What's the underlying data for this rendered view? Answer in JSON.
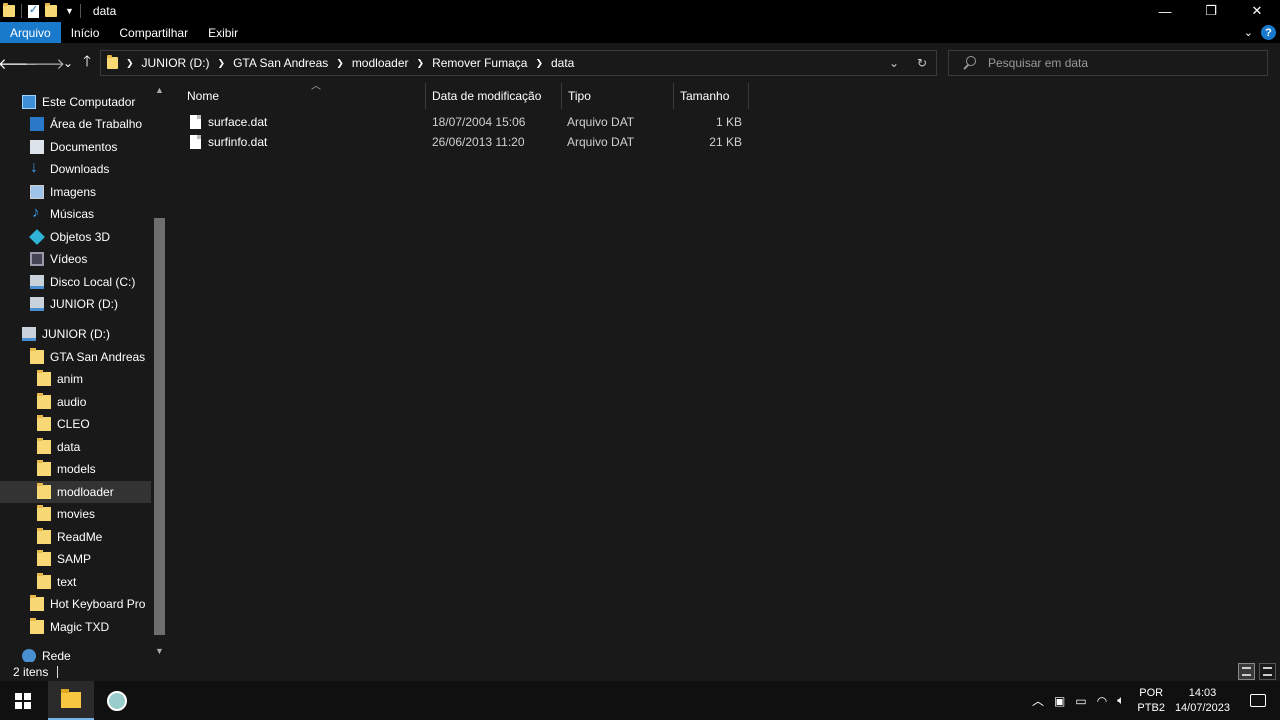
{
  "window": {
    "title": "data",
    "controls": [
      "—",
      "❐",
      "✕"
    ]
  },
  "ribbon": {
    "tabs": [
      {
        "label": "Arquivo",
        "active": true
      },
      {
        "label": "Início",
        "active": false
      },
      {
        "label": "Compartilhar",
        "active": false
      },
      {
        "label": "Exibir",
        "active": false
      }
    ],
    "help": "?"
  },
  "nav": {
    "back": "🡐",
    "forward": "🡒",
    "recent": "⌄",
    "up": "🡑"
  },
  "address": {
    "breadcrumbs": [
      "JUNIOR (D:)",
      "GTA San Andreas",
      "modloader",
      "Remover Fumaça",
      "data"
    ]
  },
  "search": {
    "placeholder": "Pesquisar em data"
  },
  "navpane": {
    "items": [
      {
        "label": "Este Computador",
        "icon": "computer-icon"
      },
      {
        "label": "Área de Trabalho",
        "icon": "desktop-icon"
      },
      {
        "label": "Documentos",
        "icon": "documents-icon"
      },
      {
        "label": "Downloads",
        "icon": "downloads-icon"
      },
      {
        "label": "Imagens",
        "icon": "images-icon"
      },
      {
        "label": "Músicas",
        "icon": "music-icon"
      },
      {
        "label": "Objetos 3D",
        "icon": "objects-3d-icon"
      },
      {
        "label": "Vídeos",
        "icon": "videos-icon"
      },
      {
        "label": "Disco Local (C:)",
        "icon": "drive-icon"
      },
      {
        "label": "JUNIOR (D:)",
        "icon": "network-drive-icon"
      },
      {
        "label": "JUNIOR (D:)",
        "icon": "network-drive-icon"
      },
      {
        "label": "GTA San Andreas",
        "icon": "folder-icon"
      },
      {
        "label": "anim",
        "icon": "folder-icon"
      },
      {
        "label": "audio",
        "icon": "folder-icon"
      },
      {
        "label": "CLEO",
        "icon": "folder-icon"
      },
      {
        "label": "data",
        "icon": "folder-icon"
      },
      {
        "label": "models",
        "icon": "folder-icon"
      },
      {
        "label": "modloader",
        "icon": "folder-icon",
        "selected": true
      },
      {
        "label": "movies",
        "icon": "folder-icon"
      },
      {
        "label": "ReadMe",
        "icon": "folder-icon"
      },
      {
        "label": "SAMP",
        "icon": "folder-icon"
      },
      {
        "label": "text",
        "icon": "folder-icon"
      },
      {
        "label": "Hot Keyboard Pro",
        "icon": "folder-icon"
      },
      {
        "label": "Magic TXD",
        "icon": "folder-icon"
      },
      {
        "label": "Rede",
        "icon": "network-icon"
      }
    ]
  },
  "columns": {
    "name": "Nome",
    "modified": "Data de modificação",
    "type": "Tipo",
    "size": "Tamanho"
  },
  "files": [
    {
      "name": "surface.dat",
      "modified": "18/07/2004 15:06",
      "type": "Arquivo DAT",
      "size": "1 KB"
    },
    {
      "name": "surfinfo.dat",
      "modified": "26/06/2013 11:20",
      "type": "Arquivo DAT",
      "size": "21 KB"
    }
  ],
  "status": {
    "count": "2 itens"
  },
  "taskbar": {
    "lang_top": "POR",
    "lang_bottom": "PTB2",
    "time": "14:03",
    "date": "14/07/2023"
  },
  "colors": {
    "accent": "#1979ca",
    "background": "#191919",
    "folder": "#f8d775"
  }
}
